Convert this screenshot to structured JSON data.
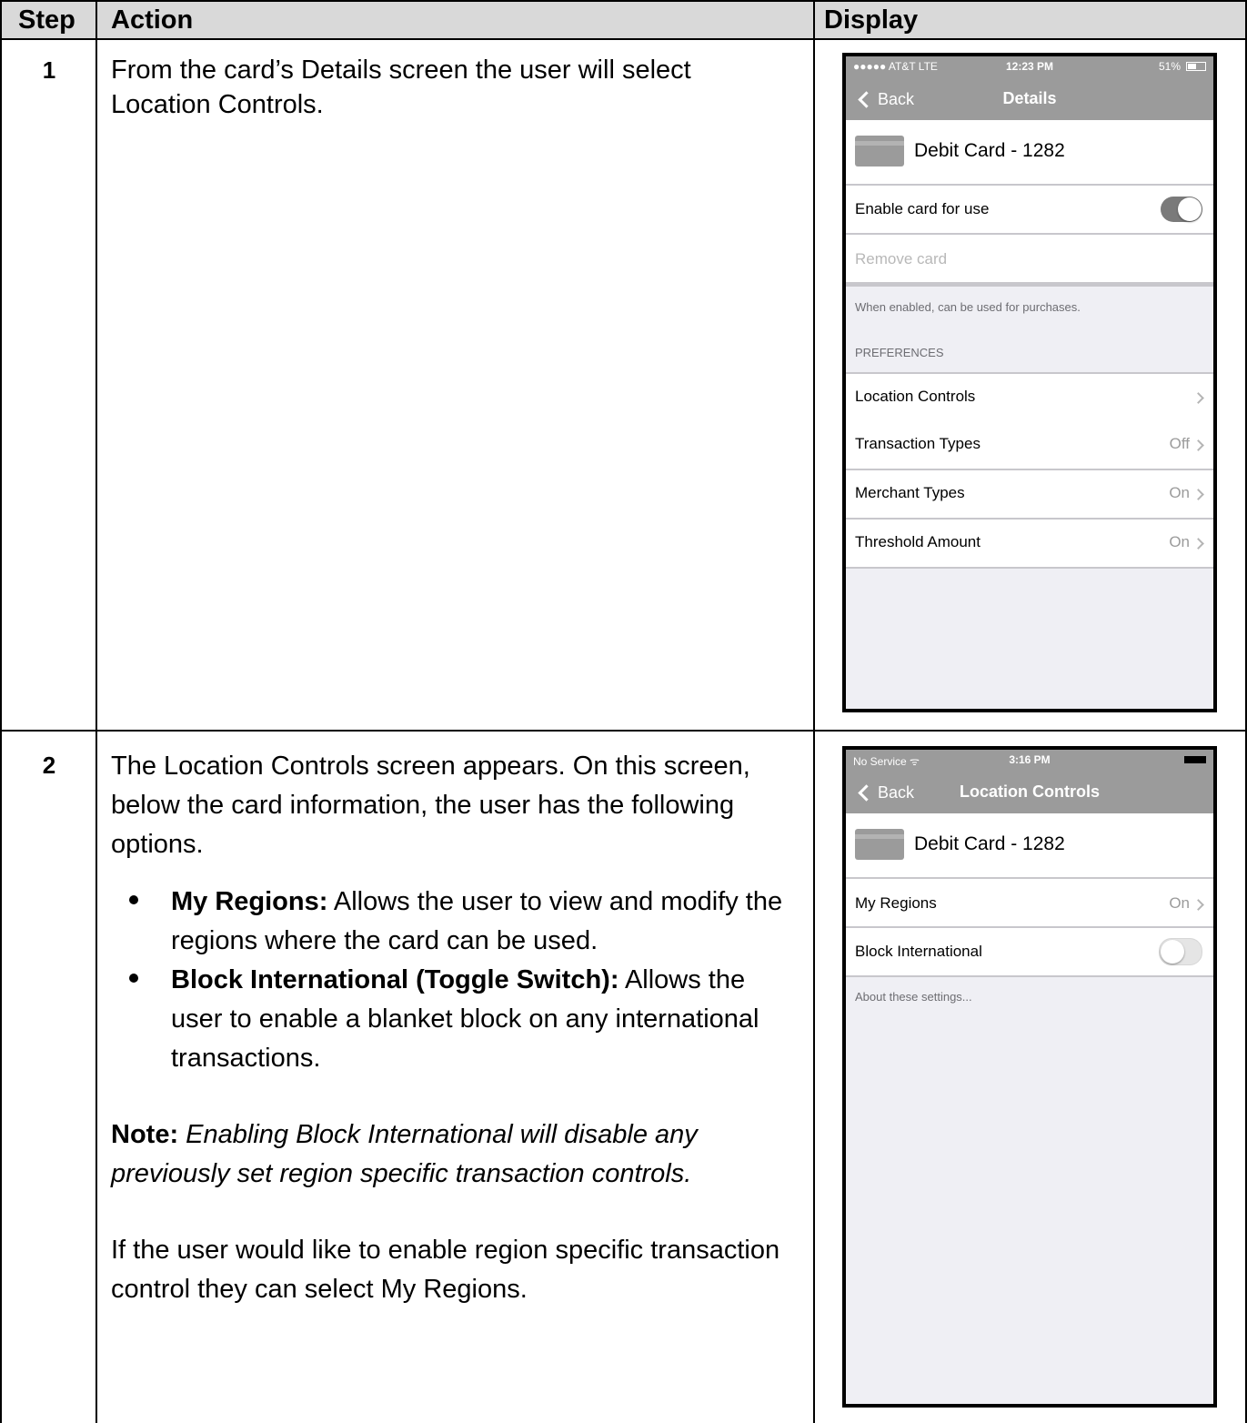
{
  "table": {
    "headers": {
      "step": "Step",
      "action": "Action",
      "display": "Display"
    },
    "rows": [
      {
        "step": "1",
        "action_text": "From the card’s Details screen the user will select Location Controls."
      },
      {
        "step": "2",
        "intro": "The Location Controls screen appears.  On this screen, below the card information, the user has the following options.",
        "bullets": [
          {
            "term": "My Regions:",
            "desc": "  Allows the user to view and modify the regions where the card can be used."
          },
          {
            "term": "Block International (Toggle Switch):",
            "desc": "  Allows the user to enable a blanket block on any international transactions."
          }
        ],
        "note_label": "Note:",
        "note_text": "  Enabling Block International will disable any previously set region specific transaction controls.",
        "closing": "If the user would like to enable region specific transaction control they can select My Regions."
      }
    ]
  },
  "screen1": {
    "status_left": "●●●●● AT&T  LTE",
    "status_time": "12:23 PM",
    "status_right": "51%",
    "back_label": "Back",
    "title": "Details",
    "card_name": "Debit Card - 1282",
    "enable_label": "Enable card for use",
    "enable_state": "on",
    "remove_label": "Remove card",
    "enable_hint": "When enabled, can be used for purchases.",
    "section_header": "PREFERENCES",
    "items": [
      {
        "label": "Location Controls",
        "value": ""
      },
      {
        "label": "Transaction Types",
        "value": "Off"
      },
      {
        "label": "Merchant Types",
        "value": "On"
      },
      {
        "label": "Threshold Amount",
        "value": "On"
      }
    ]
  },
  "screen2": {
    "status_left": "No Service ᯤ",
    "status_time": "3:16 PM",
    "back_label": "Back",
    "title": "Location Controls",
    "card_name": "Debit Card - 1282",
    "my_regions_label": "My Regions",
    "my_regions_value": "On",
    "block_label": "Block International",
    "block_state": "off",
    "about_label": "About these settings..."
  }
}
